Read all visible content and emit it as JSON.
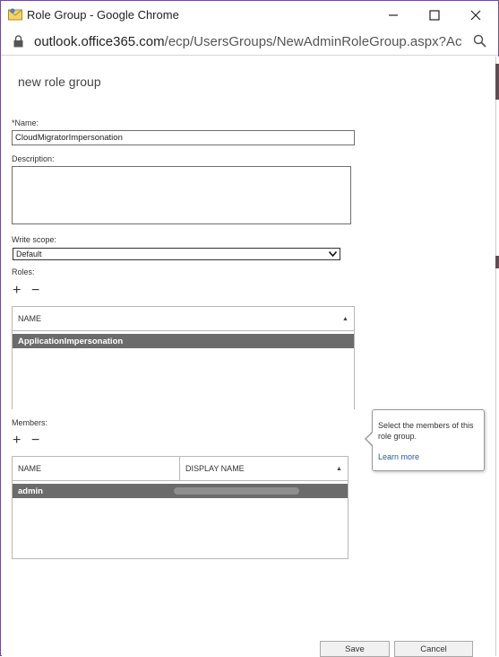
{
  "window": {
    "title": "Role Group - Google Chrome",
    "url_domain": "outlook.office365.com",
    "url_path": "/ecp/UsersGroups/NewAdminRoleGroup.aspx?Activit..."
  },
  "page": {
    "title": "new role group"
  },
  "form": {
    "name_label": "*Name:",
    "name_value": "CloudMigratorImpersonation",
    "description_label": "Description:",
    "description_value": "",
    "write_scope_label": "Write scope:",
    "write_scope_value": "Default",
    "roles_label": "Roles:",
    "members_label": "Members:"
  },
  "roles": {
    "add_glyph": "+",
    "remove_glyph": "−",
    "columns": [
      "NAME"
    ],
    "rows": [
      "ApplicationImpersonation"
    ]
  },
  "members": {
    "add_glyph": "+",
    "remove_glyph": "−",
    "columns": [
      "NAME",
      "DISPLAY NAME"
    ],
    "rows": [
      {
        "name": "admin",
        "display_name": ""
      }
    ]
  },
  "callout": {
    "text": "Select the members of this role group.",
    "link": "Learn more"
  },
  "footer": {
    "save_label": "Save",
    "cancel_label": "Cancel"
  },
  "colors": {
    "selected_row": "#6b6b6b",
    "link": "#1f5a9a",
    "window_border": "#6b4f8f"
  }
}
